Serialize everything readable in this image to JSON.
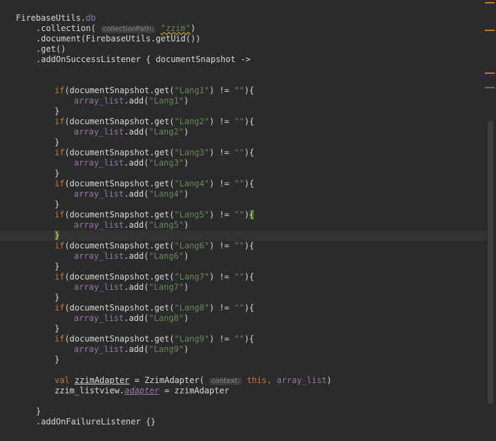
{
  "editor": {
    "lines": {
      "l1_obj": "FirebaseUtils",
      "l1_db": "db",
      "l2_method": ".collection(",
      "l2_hint": "collectionPath:",
      "l2_str": "\"zzim\"",
      "l2_end": ")",
      "l3": ".document(FirebaseUtils.getUid())",
      "l4": ".get()",
      "l5": ".addOnSuccessListener { documentSnapshot ->",
      "blocks": [
        {
          "lang": "\"Lang1\""
        },
        {
          "lang": "\"Lang2\""
        },
        {
          "lang": "\"Lang3\""
        },
        {
          "lang": "\"Lang4\""
        },
        {
          "lang": "\"Lang5\""
        },
        {
          "lang": "\"Lang6\""
        },
        {
          "lang": "\"Lang7\""
        },
        {
          "lang": "\"Lang8\""
        },
        {
          "lang": "\"Lang9\""
        }
      ],
      "kw_if": "if",
      "get_call": "(documentSnapshot.get(",
      "neq": ") != ",
      "empty": "\"\"",
      "close_paren": ")",
      "open_brace": "{",
      "close_brace": "}",
      "array_list": "array_list",
      "add_call": ".add(",
      "val_kw": "val",
      "var_name": "zzimAdapter",
      "assign_ctor": " = ZzimAdapter(",
      "ctx_hint": "context:",
      "this_kw": "this,",
      "array_arg": "array_list",
      "ctor_end": ")",
      "listview": "zzim_listview.",
      "adapter_field": "adapter",
      "adapter_assign": " = zzimAdapter",
      "failure": ".addOnFailureListener {}"
    }
  },
  "colors": {
    "background": "#2b2b2b",
    "keyword": "#cc7832",
    "string": "#6a8759",
    "property": "#9876aa",
    "text": "#d8d8d8",
    "marker": "#c27d1b"
  }
}
